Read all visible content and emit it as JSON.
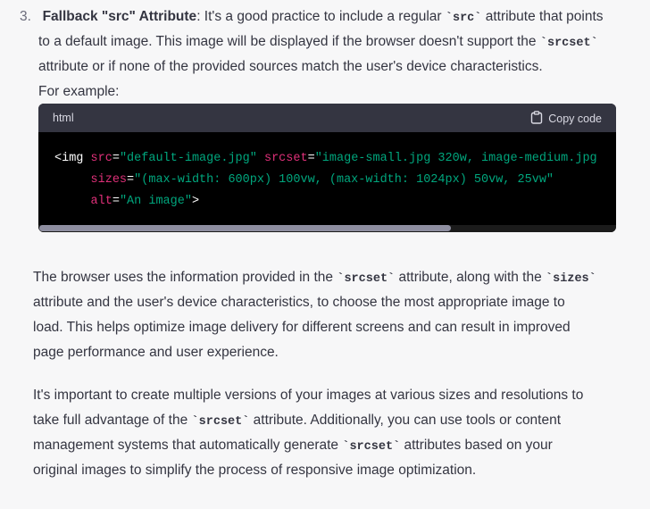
{
  "item3": {
    "number": "3.",
    "title": "Fallback \"src\" Attribute",
    "line1_after_title": ": It's a good practice to include a regular ",
    "code_src": "src",
    "line1_end": " attribute that points",
    "line2_start": "to a default image. This image will be displayed if the browser doesn't support the ",
    "code_srcset": "srcset",
    "line3": "attribute or if none of the provided sources match the user's device characteristics.",
    "for_example": "For example:"
  },
  "code_block": {
    "language": "html",
    "copy_label": "Copy code",
    "line1": {
      "tag_open": "<img ",
      "attr_src": "src",
      "eq1": "=",
      "val_src": "\"default-image.jpg\"",
      "space1": " ",
      "attr_srcset": "srcset",
      "eq2": "=",
      "val_srcset": "\"image-small.jpg 320w, image-medium.jpg"
    },
    "line2": {
      "indent": "     ",
      "attr_sizes": "sizes",
      "eq": "=",
      "val_sizes": "\"(max-width: 600px) 100vw, (max-width: 1024px) 50vw, 25vw\""
    },
    "line3": {
      "indent": "     ",
      "attr_alt": "alt",
      "eq": "=",
      "val_alt": "\"An image\"",
      "tag_close": ">"
    }
  },
  "paragraph1": {
    "l1_start": "The browser uses the information provided in the ",
    "code_srcset": "srcset",
    "l1_mid": " attribute, along with the ",
    "code_sizes": "sizes",
    "l2": "attribute and the user's device characteristics, to choose the most appropriate image to",
    "l3": "load. This helps optimize image delivery for different screens and can result in improved",
    "l4": "page performance and user experience."
  },
  "paragraph2": {
    "l1": "It's important to create multiple versions of your images at various sizes and resolutions to",
    "l2_start": "take full advantage of the ",
    "code_srcset": "srcset",
    "l2_end": " attribute. Additionally, you can use tools or content",
    "l3": "management systems that automatically generate ",
    "code_srcset2": "srcset",
    "l3_end": " attributes based on your",
    "l4": "original images to simplify the process of responsive image optimization."
  },
  "tick": "`",
  "colors": {
    "background": "#f7f7f8",
    "text": "#343541",
    "code_bg": "#000000",
    "code_header": "#343541",
    "attr": "#df3079",
    "string": "#00a67d"
  },
  "icons": {
    "copy": "clipboard-icon"
  }
}
